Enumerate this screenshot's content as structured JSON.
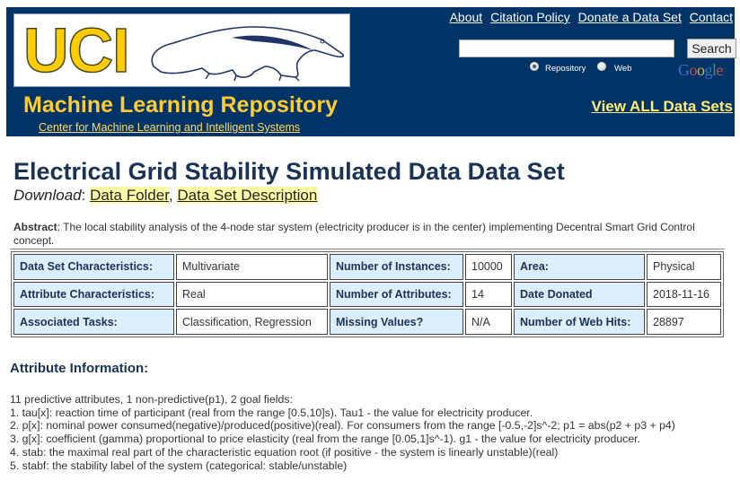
{
  "header": {
    "logo_text": "UCI",
    "repo_title": "Machine Learning Repository",
    "center_link": "Center for Machine Learning and Intelligent Systems",
    "top_links": [
      "About",
      "Citation Policy",
      "Donate a Data Set",
      "Contact"
    ],
    "search": {
      "value": "",
      "placeholder": "",
      "button_label": "Search"
    },
    "radio_options": [
      {
        "label": "Repository",
        "checked": true
      },
      {
        "label": "Web",
        "checked": false
      }
    ],
    "google_label": "Google",
    "view_all_label": "View ALL Data Sets",
    "colors": {
      "navy": "#003366",
      "gold": "#ffcc33"
    }
  },
  "page": {
    "title": "Electrical Grid Stability Simulated Data Data Set",
    "download_label": "Download",
    "download_links": [
      "Data Folder",
      "Data Set Description"
    ],
    "abstract_label": "Abstract",
    "abstract_text": "The local stability analysis of the 4-node star system (electricity producer is in the center) implementing Decentral Smart Grid Control concept."
  },
  "info_table": {
    "rows": [
      [
        {
          "label": "Data Set Characteristics:",
          "value": "Multivariate"
        },
        {
          "label": "Number of Instances:",
          "value": "10000"
        },
        {
          "label": "Area:",
          "value": "Physical"
        }
      ],
      [
        {
          "label": "Attribute Characteristics:",
          "value": "Real"
        },
        {
          "label": "Number of Attributes:",
          "value": "14"
        },
        {
          "label": "Date Donated",
          "value": "2018-11-16"
        }
      ],
      [
        {
          "label": "Associated Tasks:",
          "value": "Classification, Regression"
        },
        {
          "label": "Missing Values?",
          "value": "N/A"
        },
        {
          "label": "Number of Web Hits:",
          "value": "28897"
        }
      ]
    ]
  },
  "attributes": {
    "title": "Attribute Information:",
    "lines": [
      "11 predictive attributes, 1 non-predictive(p1), 2 goal fields:",
      "1. tau[x]: reaction time of participant (real from the range [0.5,10]s). Tau1 - the value for electricity producer.",
      "2. p[x]: nominal power consumed(negative)/produced(positive)(real). For consumers from the range [-0.5,-2]s^-2; p1 = abs(p2 + p3 + p4)",
      "3. g[x]: coefficient (gamma) proportional to price elasticity (real from the range [0.05,1]s^-1). g1 - the value for electricity producer.",
      "4. stab: the maximal real part of the characteristic equation root (if positive - the system is linearly unstable)(real)",
      "5. stabf: the stability label of the system (categorical: stable/unstable)"
    ]
  }
}
